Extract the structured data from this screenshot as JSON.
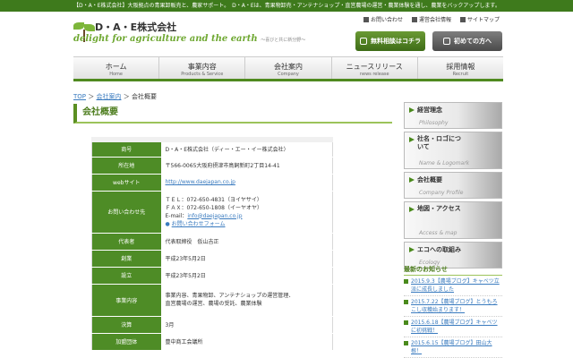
{
  "topbar": {
    "text": "【D・A・E株式会社】大阪拠点の青果卸販売と、農家サポート。　D・A・Eは、青果物卸売・アンテナショップ・直営農場の運営・農業体験を通し、農業をバックアップします。"
  },
  "header": {
    "company_name": "D・A・E株式会社",
    "tagline": "delight for agriculture and the earth",
    "tagline_jp": "～喜びと共に新分野～",
    "util_links": [
      "お問い合わせ",
      "運営会社情報",
      "サイトマップ"
    ],
    "btn_consult": "無料相談はコチラ",
    "btn_first": "初めての方へ"
  },
  "nav": [
    {
      "jp": "ホーム",
      "en": "Home"
    },
    {
      "jp": "事業内容",
      "en": "Products & Service"
    },
    {
      "jp": "会社案内",
      "en": "Company"
    },
    {
      "jp": "ニュースリリース",
      "en": "news release"
    },
    {
      "jp": "採用情報",
      "en": "Recruit"
    }
  ],
  "breadcrumb": {
    "top": "TOP",
    "sep1": "＞",
    "company": "会社案内",
    "sep2": "＞",
    "current": "会社概要"
  },
  "page_title": "会社概要",
  "info": {
    "name_k": "商号",
    "name_v": "D・A・E株式会社（ディー・エー・イー株式会社）",
    "addr_k": "所在地",
    "addr_v": "〒566-0065大阪府摂津市鳥飼新町2丁目14-41",
    "web_k": "webサイト",
    "web_v": "http://www.daejapan.co.jp",
    "contact_k": "お問い合わせ先",
    "tel": "ＴＥＬ：072-650-4831（ヨイヤサイ）",
    "fax": "ＦＡＸ：072-650-1808（イーヤオヤ）",
    "email_label": "E-mail：",
    "email": "info@daejapan.co.jp",
    "form_link": "お問い合わせフォーム",
    "rep_k": "代表者",
    "rep_v": "代表取締役　仮山吉正",
    "found_k": "創業",
    "found_v": "平成23年5月2日",
    "est_k": "設立",
    "est_v": "平成23年5月2日",
    "biz_k": "事業内容",
    "biz_v1": "事業内容、青果物卸、アンテナショップの運営管理、",
    "biz_v2": "直営農場の運営、農場の受託、農業体験",
    "fiscal_k": "決算",
    "fiscal_v": "3月",
    "org_k": "加盟団体",
    "org_v": "豊中商工会議所"
  },
  "sidebar": [
    {
      "jp": "経営理念",
      "en": "Philosophy"
    },
    {
      "jp": "社名・ロゴについて",
      "en": "Name & Logomark"
    },
    {
      "jp": "会社概要",
      "en": "Company Profile"
    },
    {
      "jp": "地図・アクセス",
      "en": "Access & map"
    },
    {
      "jp": "エコへの取組み",
      "en": "Ecology"
    }
  ],
  "news": {
    "title": "最新のお知らせ",
    "items": [
      "2015.9.3【農場ブログ】キャベツ立派に成長しました",
      "2015.7.22【農場ブログ】とうもろこし収穫始まります！",
      "2015.6.18【農場ブログ】キャベツに初挑戦！",
      "2015.6.15【農場ブログ】田山大根！"
    ]
  },
  "colors": {
    "brand_green": "#4e8c26",
    "topbar": "#3e7a1c",
    "link": "#3a7bbf"
  }
}
